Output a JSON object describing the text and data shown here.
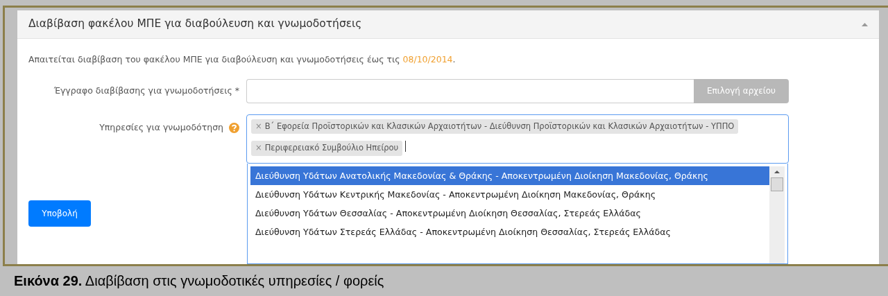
{
  "panel": {
    "title": "Διαβίβαση φακέλου ΜΠΕ για διαβούλευση και γνωμοδοτήσεις",
    "expanded": true
  },
  "notice": {
    "text": "Απαιτείται διαβίβαση του φακέλου ΜΠΕ για διαβούλευση και γνωμοδοτήσεις έως τις ",
    "date": "08/10/2014",
    "end": "."
  },
  "fields": [
    {
      "kind": "file",
      "label": "Έγγραφο διαβίβασης για γνωμοδοτήσεις *",
      "button": "Επιλογή αρχείου"
    },
    {
      "kind": "multiselect",
      "label": "Υπηρεσίες για γνωμοδότηση",
      "help": true,
      "tags": [
        {
          "remove": "×",
          "label": "Β΄ Εφορεία Προϊστορικών και Κλασικών Αρχαιοτήτων - Διεύθυνση Προϊστορικών και Κλασικών Αρχαιοτήτων - ΥΠΠΟ"
        },
        {
          "remove": "×",
          "label": "Περιφερειακό Συμβούλιο Ηπείρου"
        }
      ],
      "options": [
        {
          "label": "Διεύθυνση Υδάτων Ανατολικής Μακεδονίας & Θράκης - Αποκεντρωμένη Διοίκηση Μακεδονίας, Θράκης",
          "selected": true
        },
        {
          "label": "Διεύθυνση Υδάτων Κεντρικής Μακεδονίας - Αποκεντρωμένη Διοίκηση Μακεδονίας, Θράκης",
          "selected": false
        },
        {
          "label": "Διεύθυνση Υδάτων Θεσσαλίας - Αποκεντρωμένη Διοίκηση Θεσσαλίας, Στερεάς Ελλάδας",
          "selected": false
        },
        {
          "label": "Διεύθυνση Υδάτων Στερεάς Ελλάδας - Αποκεντρωμένη Διοίκηση Θεσσαλίας, Στερεάς Ελλάδας",
          "selected": false
        }
      ]
    }
  ],
  "submit": "Υποβολή",
  "caption": {
    "number": "Εικόνα 29.",
    "text": "Διαβίβαση στις γνωμοδοτικές υπηρεσίες / φορείς"
  }
}
